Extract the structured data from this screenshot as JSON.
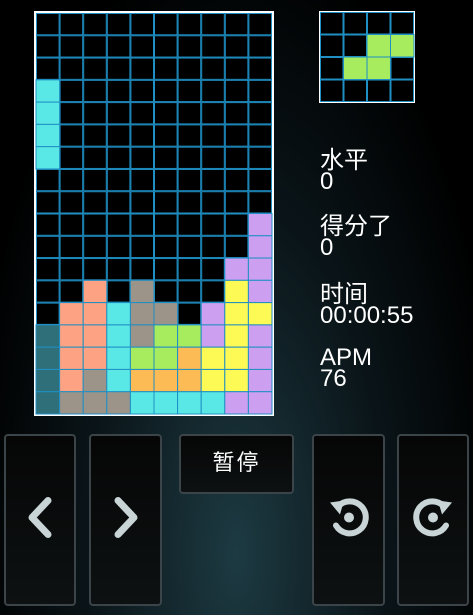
{
  "board": {
    "cols": 10,
    "rows": 17,
    "grid_color": "#1f8fc4",
    "frame_color": "#ffffff",
    "colors": {
      "C": "#5ae8e6",
      "O": "#fda383",
      "T": "#9c9389",
      "G": "#a6ec5e",
      "Y": "#fdfa55",
      "P": "#cc9ff0",
      "D": "#2e6f7a",
      "A": "#fcbb55"
    },
    "cells": [
      "..........",
      "..........",
      "..........",
      "C.........",
      "C.........",
      "C.........",
      "C.........",
      "..........",
      "..........",
      ".........P",
      ".........P",
      "........PP",
      "..O.T...YP",
      ".OOCTT.PYY",
      "DOOCTGGPYP",
      "DOOCGGAYYP",
      "DOTCAAAYYP",
      "DTTTCCCCPP"
    ]
  },
  "next_piece": {
    "cols": 4,
    "rows": 4,
    "color": "#a6ec5e",
    "cells": [
      "....",
      "..XX",
      ".XX.",
      "...."
    ]
  },
  "stats": {
    "level_label": "水平",
    "level_value": "0",
    "score_label": "得分了",
    "score_value": "0",
    "time_label": "时间",
    "time_value": "00:00:55",
    "apm_label": "APM",
    "apm_value": "76"
  },
  "controls": {
    "pause_label": "暂停",
    "left_icon": "chevron-left-icon",
    "right_icon": "chevron-right-icon",
    "rotate_ccw_icon": "rotate-ccw-icon",
    "rotate_cw_icon": "rotate-cw-icon"
  }
}
